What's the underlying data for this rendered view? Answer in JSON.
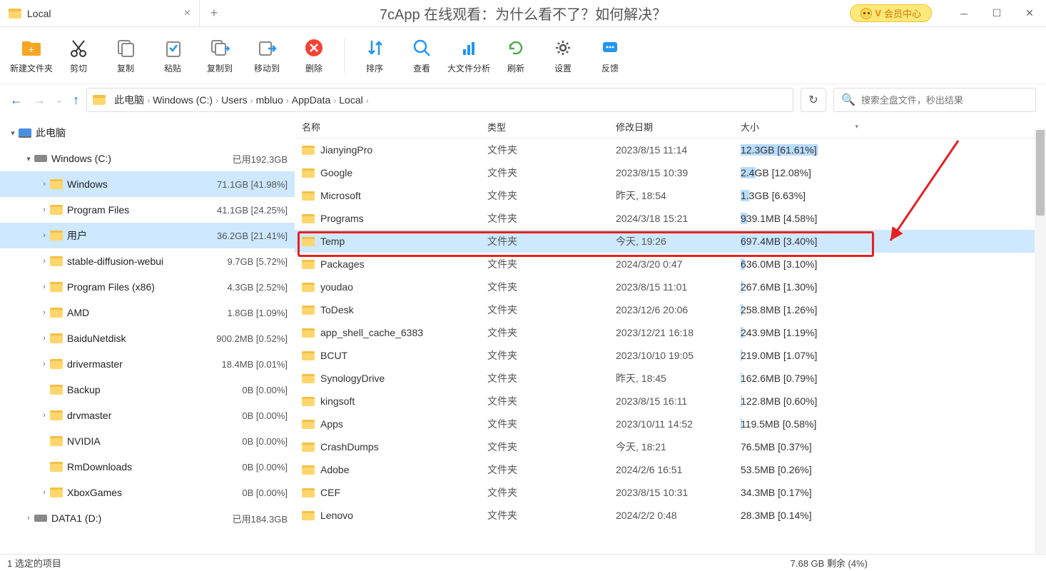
{
  "tab": {
    "title": "Local"
  },
  "page_title": "7cApp 在线观看：为什么看不了？如何解决？",
  "vip_label": "会员中心",
  "toolbar": [
    {
      "id": "new-folder",
      "label": "新建文件夹",
      "color": "#f5a623"
    },
    {
      "id": "cut",
      "label": "剪切"
    },
    {
      "id": "copy",
      "label": "复制"
    },
    {
      "id": "paste",
      "label": "粘贴"
    },
    {
      "id": "copy-to",
      "label": "复制到"
    },
    {
      "id": "move-to",
      "label": "移动到"
    },
    {
      "id": "delete",
      "label": "删除"
    },
    {
      "sep": true
    },
    {
      "id": "sort",
      "label": "排序"
    },
    {
      "id": "view",
      "label": "查看"
    },
    {
      "id": "bigfile",
      "label": "大文件分析"
    },
    {
      "id": "refresh",
      "label": "刷新"
    },
    {
      "id": "settings",
      "label": "设置"
    },
    {
      "id": "feedback",
      "label": "反馈"
    }
  ],
  "breadcrumb": [
    "此电脑",
    "Windows (C:)",
    "Users",
    "mbluo",
    "AppData",
    "Local"
  ],
  "search_placeholder": "搜索全盘文件，秒出结果",
  "columns": {
    "name": "名称",
    "type": "类型",
    "date": "修改日期",
    "size": "大小"
  },
  "tree": [
    {
      "indent": 0,
      "chev": "▾",
      "icon": "pc",
      "label": "此电脑",
      "size": ""
    },
    {
      "indent": 1,
      "chev": "▾",
      "icon": "drive",
      "label": "Windows (C:)",
      "size": "已用192.3GB"
    },
    {
      "indent": 2,
      "chev": "›",
      "icon": "folder",
      "label": "Windows",
      "size": "71.1GB [41.98%]",
      "selected": true
    },
    {
      "indent": 2,
      "chev": "›",
      "icon": "folder",
      "label": "Program Files",
      "size": "41.1GB [24.25%]"
    },
    {
      "indent": 2,
      "chev": "›",
      "icon": "folder",
      "label": "用户",
      "size": "36.2GB [21.41%]",
      "selected": true
    },
    {
      "indent": 2,
      "chev": "›",
      "icon": "folder",
      "label": "stable-diffusion-webui",
      "size": "9.7GB [5.72%]"
    },
    {
      "indent": 2,
      "chev": "›",
      "icon": "folder",
      "label": "Program Files (x86)",
      "size": "4.3GB [2.52%]"
    },
    {
      "indent": 2,
      "chev": "›",
      "icon": "folder",
      "label": "AMD",
      "size": "1.8GB [1.09%]"
    },
    {
      "indent": 2,
      "chev": "›",
      "icon": "folder",
      "label": "BaiduNetdisk",
      "size": "900.2MB [0.52%]"
    },
    {
      "indent": 2,
      "chev": "›",
      "icon": "folder",
      "label": "drivermaster",
      "size": "18.4MB [0.01%]"
    },
    {
      "indent": 2,
      "chev": "",
      "icon": "folder",
      "label": "Backup",
      "size": "0B [0.00%]"
    },
    {
      "indent": 2,
      "chev": "›",
      "icon": "folder",
      "label": "drvmaster",
      "size": "0B [0.00%]"
    },
    {
      "indent": 2,
      "chev": "",
      "icon": "folder",
      "label": "NVIDIA",
      "size": "0B [0.00%]"
    },
    {
      "indent": 2,
      "chev": "",
      "icon": "folder",
      "label": "RmDownloads",
      "size": "0B [0.00%]"
    },
    {
      "indent": 2,
      "chev": "›",
      "icon": "folder",
      "label": "XboxGames",
      "size": "0B [0.00%]"
    },
    {
      "indent": 1,
      "chev": "›",
      "icon": "drive",
      "label": "DATA1 (D:)",
      "size": "已用184.3GB"
    }
  ],
  "files": [
    {
      "name": "JianyingPro",
      "type": "文件夹",
      "date": "2023/8/15 11:14",
      "size": "12.3GB [61.61%]",
      "pct": 62
    },
    {
      "name": "Google",
      "type": "文件夹",
      "date": "2023/8/15 10:39",
      "size": "2.4GB [12.08%]",
      "pct": 12
    },
    {
      "name": "Microsoft",
      "type": "文件夹",
      "date": "昨天, 18:54",
      "size": "1.3GB [6.63%]",
      "pct": 7
    },
    {
      "name": "Programs",
      "type": "文件夹",
      "date": "2024/3/18 15:21",
      "size": "939.1MB [4.58%]",
      "pct": 5
    },
    {
      "name": "Temp",
      "type": "文件夹",
      "date": "今天, 19:26",
      "size": "697.4MB [3.40%]",
      "pct": 4,
      "selected": true
    },
    {
      "name": "Packages",
      "type": "文件夹",
      "date": "2024/3/20 0:47",
      "size": "636.0MB [3.10%]",
      "pct": 3
    },
    {
      "name": "youdao",
      "type": "文件夹",
      "date": "2023/8/15 11:01",
      "size": "267.6MB [1.30%]",
      "pct": 2
    },
    {
      "name": "ToDesk",
      "type": "文件夹",
      "date": "2023/12/6 20:06",
      "size": "258.8MB [1.26%]",
      "pct": 2
    },
    {
      "name": "app_shell_cache_6383",
      "type": "文件夹",
      "date": "2023/12/21 16:18",
      "size": "243.9MB [1.19%]",
      "pct": 2
    },
    {
      "name": "BCUT",
      "type": "文件夹",
      "date": "2023/10/10 19:05",
      "size": "219.0MB [1.07%]",
      "pct": 1
    },
    {
      "name": "SynologyDrive",
      "type": "文件夹",
      "date": "昨天, 18:45",
      "size": "162.6MB [0.79%]",
      "pct": 1
    },
    {
      "name": "kingsoft",
      "type": "文件夹",
      "date": "2023/8/15 16:11",
      "size": "122.8MB [0.60%]",
      "pct": 1
    },
    {
      "name": "Apps",
      "type": "文件夹",
      "date": "2023/10/11 14:52",
      "size": "119.5MB [0.58%]",
      "pct": 1
    },
    {
      "name": "CrashDumps",
      "type": "文件夹",
      "date": "今天, 18:21",
      "size": "76.5MB [0.37%]",
      "pct": 0
    },
    {
      "name": "Adobe",
      "type": "文件夹",
      "date": "2024/2/6 16:51",
      "size": "53.5MB [0.26%]",
      "pct": 0
    },
    {
      "name": "CEF",
      "type": "文件夹",
      "date": "2023/8/15 10:31",
      "size": "34.3MB [0.17%]",
      "pct": 0
    },
    {
      "name": "Lenovo",
      "type": "文件夹",
      "date": "2024/2/2 0:48",
      "size": "28.3MB [0.14%]",
      "pct": 0
    }
  ],
  "status": {
    "left": "1 选定的项目",
    "right": "7.68 GB 剩余 (4%)"
  }
}
